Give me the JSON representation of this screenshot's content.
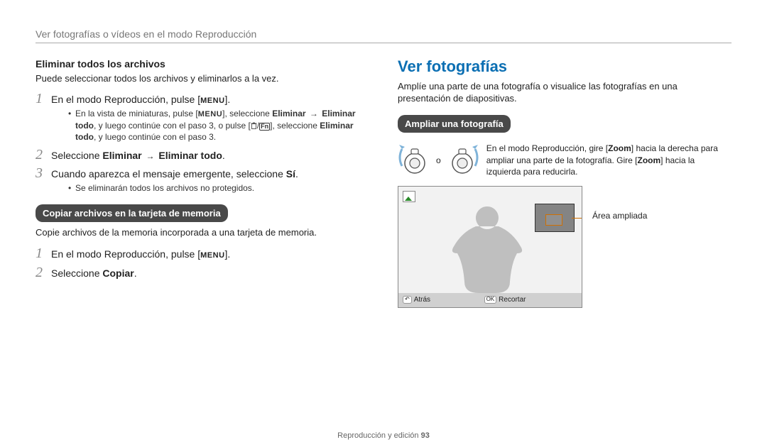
{
  "header": "Ver fotografías o vídeos en el modo Reproducción",
  "left": {
    "sub1_title": "Eliminar todos los archivos",
    "sub1_intro": "Puede seleccionar todos los archivos y eliminarlos a la vez.",
    "step1_pre": "En el modo Reproducción, pulse [",
    "menu": "MENU",
    "step1_post": "].",
    "bullet1a_pre": "En la vista de miniaturas, pulse [",
    "bullet1a_mid1": "], seleccione ",
    "bullet1a_b1": "Eliminar",
    "bullet1a_arrow": "→",
    "bullet1a_b2": "Eliminar todo",
    "bullet1a_mid2": ", y luego continúe con el paso 3, o pulse [",
    "fn": "Fn",
    "bullet1a_mid3": "], seleccione ",
    "bullet1a_b3": "Eliminar todo",
    "bullet1a_end": ", y luego continúe con el paso 3.",
    "step2_pre": "Seleccione ",
    "step2_b1": "Eliminar",
    "step2_arrow": "→",
    "step2_b2": "Eliminar todo",
    "step2_post": ".",
    "step3_pre": "Cuando aparezca el mensaje emergente, seleccione ",
    "step3_b": "Sí",
    "step3_post": ".",
    "bullet3": "Se eliminarán todos los archivos no protegidos.",
    "pill2": "Copiar archivos en la tarjeta de memoria",
    "pill2_intro": "Copie archivos de la memoria incorporada a una tarjeta de memoria.",
    "c_step1_pre": "En el modo Reproducción, pulse [",
    "c_step1_post": "].",
    "c_step2_pre": "Seleccione ",
    "c_step2_b": "Copiar",
    "c_step2_post": "."
  },
  "right": {
    "title": "Ver fotografías",
    "intro": "Amplíe una parte de una fotografía o visualice las fotografías en una presentación de diapositivas.",
    "pill": "Ampliar una fotografía",
    "o": "o",
    "zoomtext_pre": "En el modo Reproducción, gire [",
    "zoom": "Zoom",
    "zoomtext_mid": "] hacia la derecha para ampliar una parte de la fotografía. Gire [",
    "zoomtext_post": "] hacia la izquierda para reducirla.",
    "area_label": "Área ampliada",
    "back": "Atrás",
    "ok": "OK",
    "crop": "Recortar"
  },
  "footer_pre": "Reproducción y edición  ",
  "footer_num": "93",
  "nums": {
    "n1": "1",
    "n2": "2",
    "n3": "3"
  }
}
